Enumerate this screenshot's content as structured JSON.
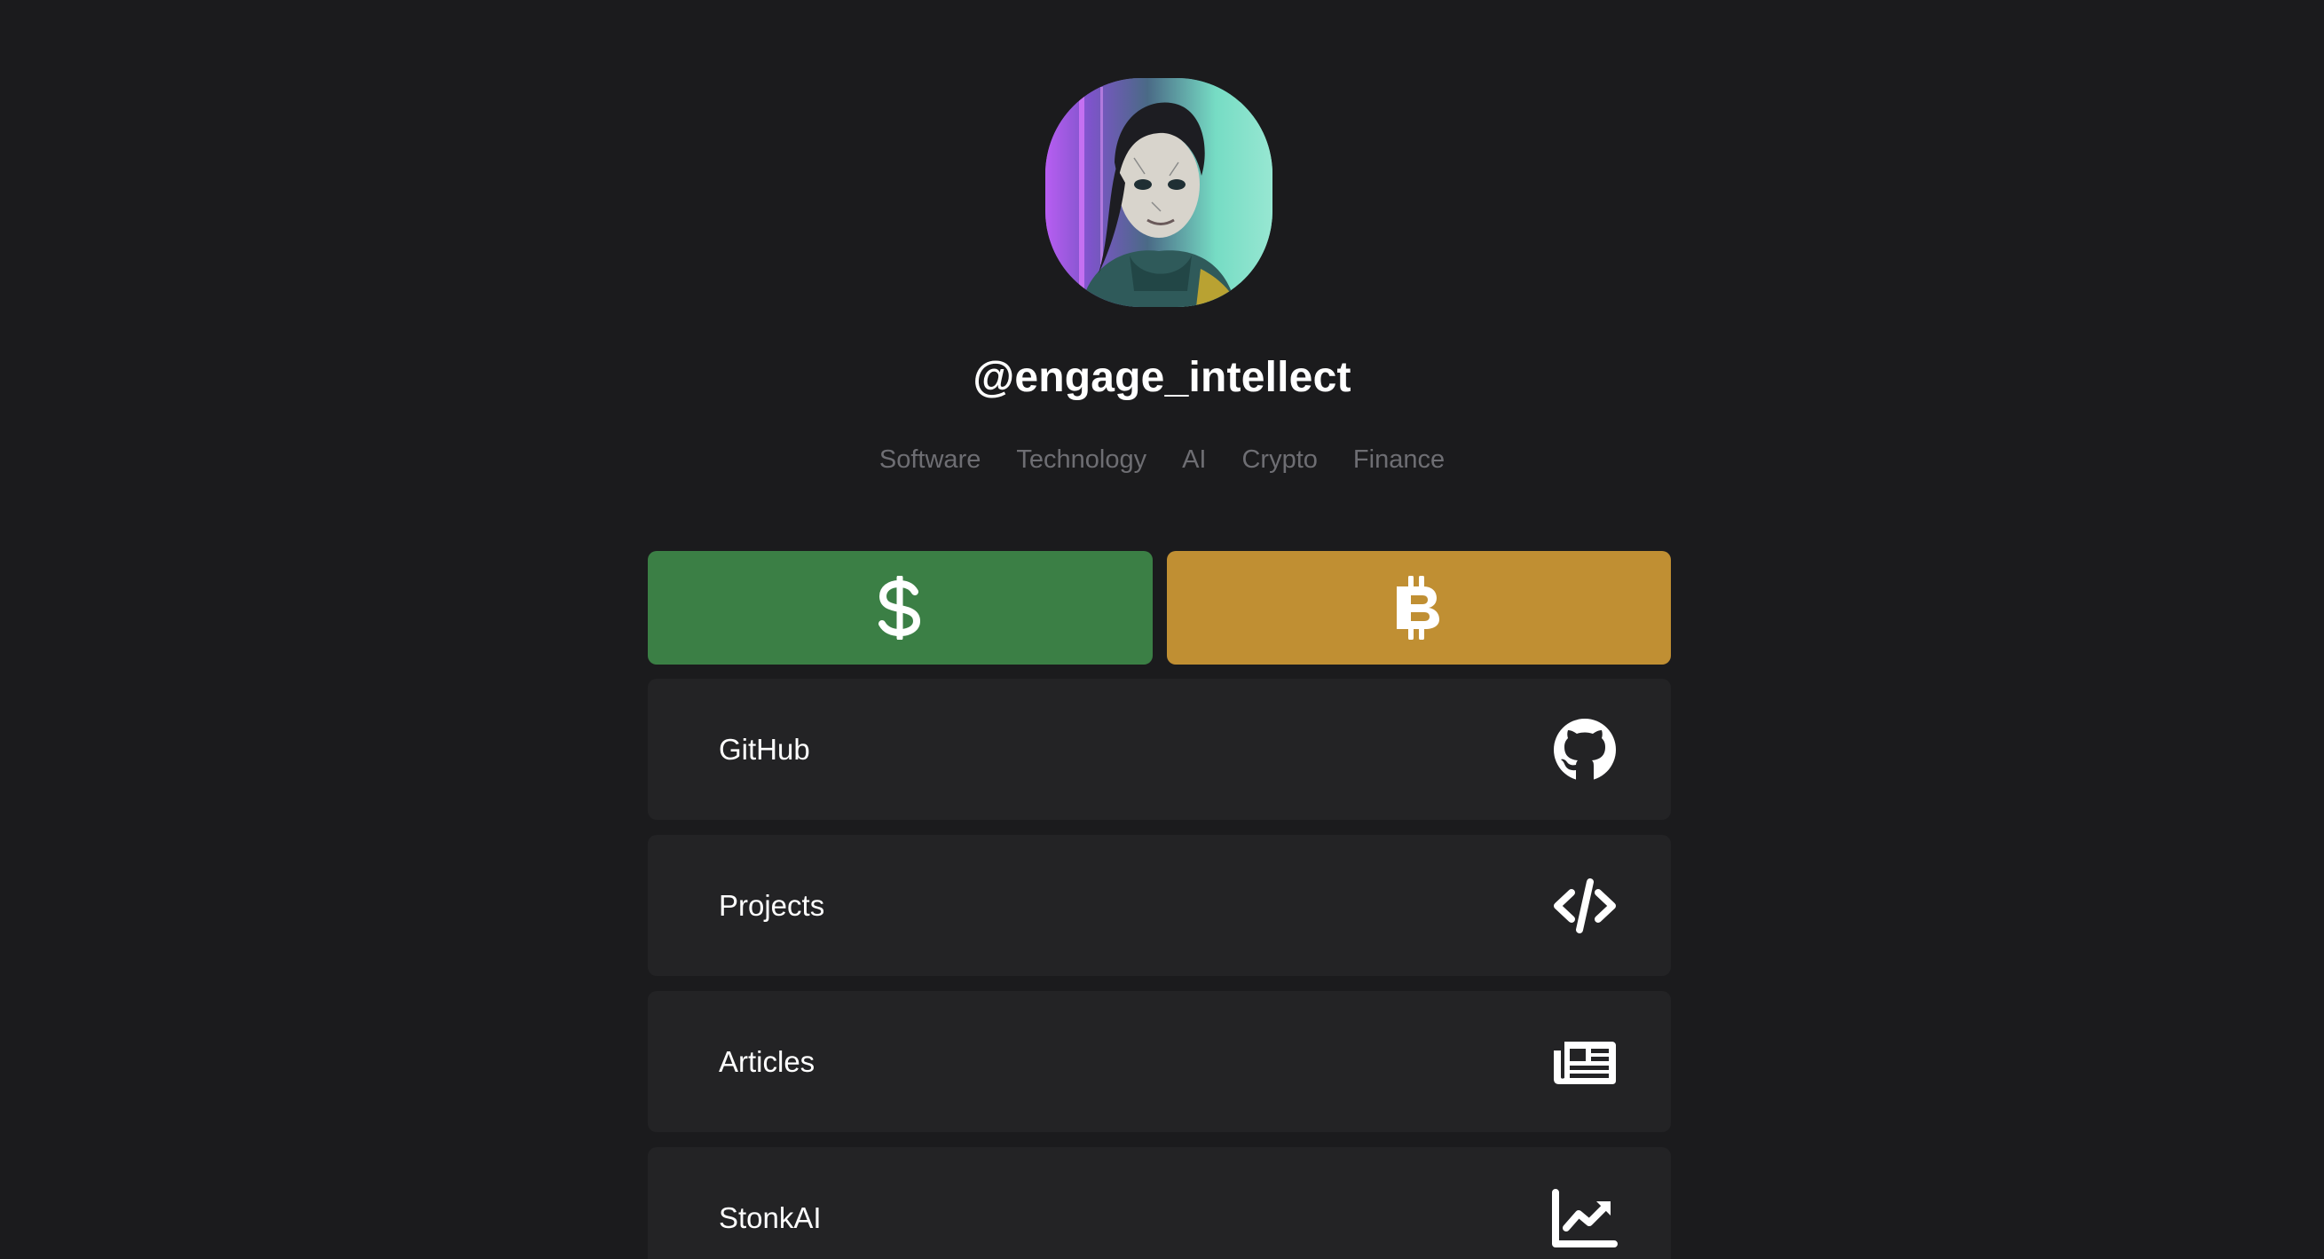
{
  "profile": {
    "handle": "@engage_intellect",
    "avatar_description": "avatar"
  },
  "tags": [
    "Software",
    "Technology",
    "AI",
    "Crypto",
    "Finance"
  ],
  "payment_buttons": [
    {
      "icon": "dollar-icon",
      "color": "#3b7f45"
    },
    {
      "icon": "bitcoin-icon",
      "color": "#c08f33"
    }
  ],
  "links": [
    {
      "label": "GitHub",
      "icon": "github-icon"
    },
    {
      "label": "Projects",
      "icon": "code-icon"
    },
    {
      "label": "Articles",
      "icon": "newspaper-icon"
    },
    {
      "label": "StonkAI",
      "icon": "chart-line-icon"
    }
  ],
  "colors": {
    "background": "#1b1b1d",
    "card": "#232325",
    "tag_text": "#6e6e73"
  }
}
